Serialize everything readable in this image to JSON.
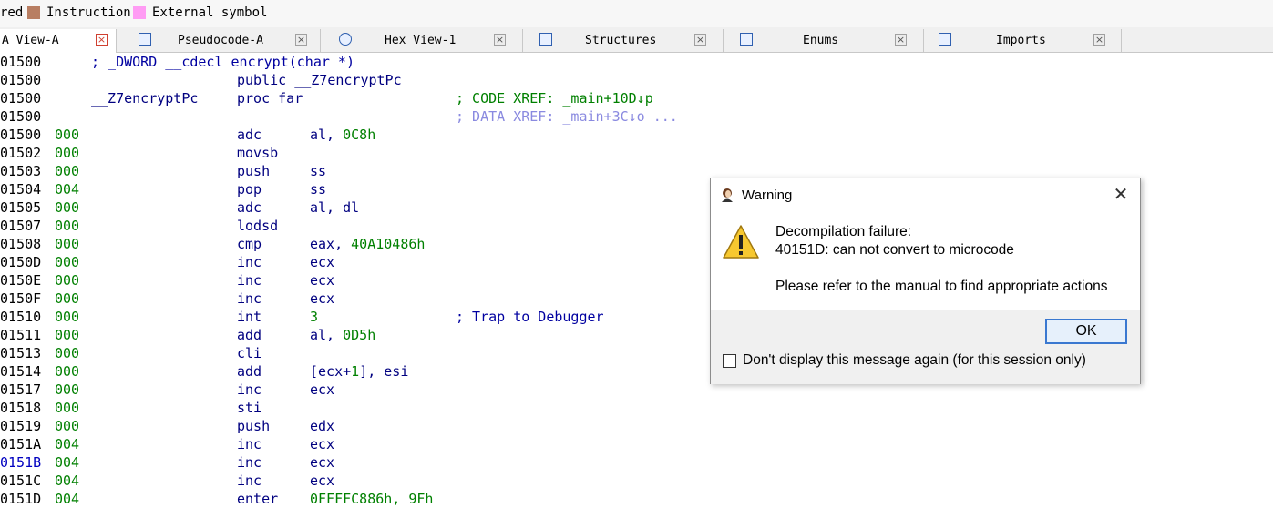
{
  "legend": {
    "items": [
      {
        "label": "red",
        "color": null
      },
      {
        "label": "Instruction",
        "color": "#b87e62"
      },
      {
        "label": "External symbol",
        "color": "#ff9cf4"
      }
    ]
  },
  "tabs": [
    {
      "label": "A View-A",
      "active": true,
      "icon": "ida-view-icon"
    },
    {
      "label": "Pseudocode-A",
      "active": false,
      "icon": "pseudocode-icon"
    },
    {
      "label": "Hex View-1",
      "active": false,
      "icon": "hex-view-icon"
    },
    {
      "label": "Structures",
      "active": false,
      "icon": "structures-icon"
    },
    {
      "label": "Enums",
      "active": false,
      "icon": "enums-icon"
    },
    {
      "label": "Imports",
      "active": false,
      "icon": "imports-icon"
    }
  ],
  "disassembly": {
    "header": [
      {
        "addr": "01500",
        "text": "; _DWORD __cdecl encrypt(char *)"
      },
      {
        "addr": "01500",
        "text": "public __Z7encryptPc"
      },
      {
        "addr": "01500",
        "label": "__Z7encryptPc",
        "text": "proc far",
        "xref": "; CODE XREF: _main+10D↓p"
      },
      {
        "addr": "01500",
        "xref2": "; DATA XREF: _main+3C↓o ..."
      }
    ],
    "rows": [
      {
        "addr": "01500",
        "sp": "000",
        "mn": "adc",
        "ops": [
          {
            "t": "al, ",
            "c": "op"
          },
          {
            "t": "0C8h",
            "c": "num"
          }
        ]
      },
      {
        "addr": "01502",
        "sp": "000",
        "mn": "movsb",
        "ops": []
      },
      {
        "addr": "01503",
        "sp": "000",
        "mn": "push",
        "ops": [
          {
            "t": "ss",
            "c": "op"
          }
        ]
      },
      {
        "addr": "01504",
        "sp": "004",
        "mn": "pop",
        "ops": [
          {
            "t": "ss",
            "c": "op"
          }
        ]
      },
      {
        "addr": "01505",
        "sp": "000",
        "mn": "adc",
        "ops": [
          {
            "t": "al, dl",
            "c": "op"
          }
        ]
      },
      {
        "addr": "01507",
        "sp": "000",
        "mn": "lodsd",
        "ops": []
      },
      {
        "addr": "01508",
        "sp": "000",
        "mn": "cmp",
        "ops": [
          {
            "t": "eax, ",
            "c": "op"
          },
          {
            "t": "40A10486h",
            "c": "num"
          }
        ]
      },
      {
        "addr": "0150D",
        "sp": "000",
        "mn": "inc",
        "ops": [
          {
            "t": "ecx",
            "c": "op"
          }
        ]
      },
      {
        "addr": "0150E",
        "sp": "000",
        "mn": "inc",
        "ops": [
          {
            "t": "ecx",
            "c": "op"
          }
        ]
      },
      {
        "addr": "0150F",
        "sp": "000",
        "mn": "inc",
        "ops": [
          {
            "t": "ecx",
            "c": "op"
          }
        ]
      },
      {
        "addr": "01510",
        "sp": "000",
        "mn": "int",
        "ops": [
          {
            "t": "3",
            "c": "num"
          }
        ],
        "comment": "; Trap to Debugger"
      },
      {
        "addr": "01511",
        "sp": "000",
        "mn": "add",
        "ops": [
          {
            "t": "al, ",
            "c": "op"
          },
          {
            "t": "0D5h",
            "c": "num"
          }
        ]
      },
      {
        "addr": "01513",
        "sp": "000",
        "mn": "cli",
        "ops": []
      },
      {
        "addr": "01514",
        "sp": "000",
        "mn": "add",
        "ops": [
          {
            "t": "[ecx+",
            "c": "op"
          },
          {
            "t": "1",
            "c": "num"
          },
          {
            "t": "], esi",
            "c": "op"
          }
        ]
      },
      {
        "addr": "01517",
        "sp": "000",
        "mn": "inc",
        "ops": [
          {
            "t": "ecx",
            "c": "op"
          }
        ]
      },
      {
        "addr": "01518",
        "sp": "000",
        "mn": "sti",
        "ops": []
      },
      {
        "addr": "01519",
        "sp": "000",
        "mn": "push",
        "ops": [
          {
            "t": "edx",
            "c": "op"
          }
        ]
      },
      {
        "addr": "0151A",
        "sp": "004",
        "mn": "inc",
        "ops": [
          {
            "t": "ecx",
            "c": "op"
          }
        ]
      },
      {
        "addr": "0151B",
        "sp": "004",
        "mn": "inc",
        "ops": [
          {
            "t": "ecx",
            "c": "op"
          }
        ],
        "highlight": true
      },
      {
        "addr": "0151C",
        "sp": "004",
        "mn": "inc",
        "ops": [
          {
            "t": "ecx",
            "c": "op"
          }
        ]
      },
      {
        "addr": "0151D",
        "sp": "004",
        "mn": "enter",
        "ops": [
          {
            "t": "0FFFFC886h, 9Fh",
            "c": "num"
          }
        ]
      }
    ]
  },
  "dialog": {
    "title": "Warning",
    "line1": "Decompilation failure:",
    "line2": "40151D: can not convert to microcode",
    "line3": "Please refer to the manual to find appropriate actions",
    "ok_label": "OK",
    "checkbox_label": "Don't display this message again (for this session only)",
    "close_glyph": "✕"
  }
}
